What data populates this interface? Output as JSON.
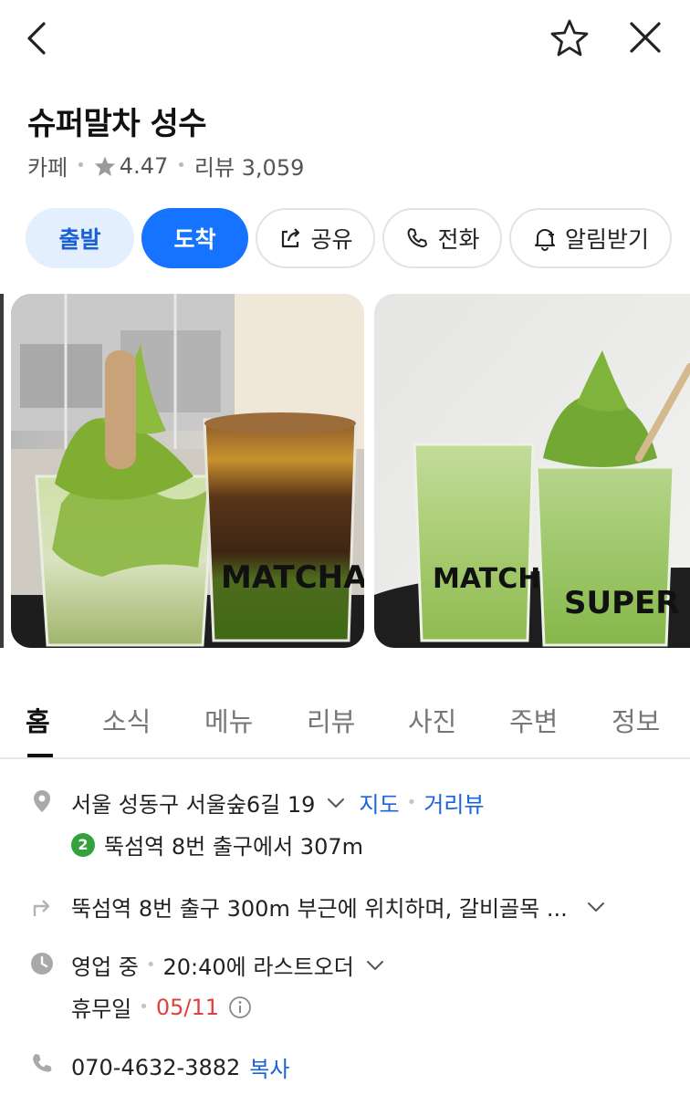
{
  "place": {
    "name": "슈퍼말차 성수",
    "category": "카페",
    "rating": "4.47",
    "review_label": "리뷰 3,059"
  },
  "actions": {
    "depart": "출발",
    "arrive": "도착",
    "share": "공유",
    "call": "전화",
    "alarm": "알림받기"
  },
  "photos": [
    {
      "cup_left_text": "",
      "cup_right_text": "MATCHA"
    },
    {
      "cup_left_text": "MATCHA",
      "cup_right_text": "SUPER"
    }
  ],
  "tabs": [
    "홈",
    "소식",
    "메뉴",
    "리뷰",
    "사진",
    "주변",
    "정보"
  ],
  "active_tab": "홈",
  "details": {
    "address": "서울 성동구 서울숲6길 19",
    "map_link": "지도",
    "street_view_link": "거리뷰",
    "subway_line": "2",
    "subway_text": "뚝섬역 8번 출구에서 307m",
    "directions": "뚝섬역 8번 출구 300m 부근에 위치하며, 갈비골목 ...",
    "status": "영업 중",
    "last_order": "20:40에 라스트오더",
    "holiday_label": "휴무일",
    "holiday_date": "05/11",
    "phone": "070-4632-3882",
    "copy_label": "복사"
  },
  "colors": {
    "primary": "#1573ff",
    "primary_light": "#e4effd",
    "matcha": "#7fb13c",
    "subway_line2": "#33a23d",
    "holiday_red": "#e0413b"
  },
  "icons": [
    "back-arrow-icon",
    "star-outline-icon",
    "close-icon",
    "star-filled-icon",
    "share-icon",
    "phone-icon",
    "bell-plus-icon",
    "location-pin-icon",
    "chevron-down-icon",
    "directions-arrow-icon",
    "clock-icon",
    "info-icon",
    "phone-small-icon"
  ]
}
